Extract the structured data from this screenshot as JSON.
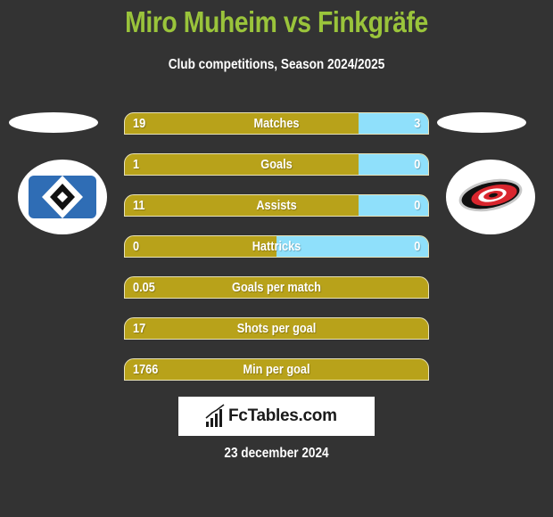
{
  "header": {
    "title": "Miro Muheim vs Finkgräfe",
    "subtitle": "Club competitions, Season 2024/2025"
  },
  "teams": {
    "left": {
      "logo": "hamburger-sv-logo"
    },
    "right": {
      "logo": "carolina-hurricanes-logo"
    }
  },
  "colors": {
    "background": "#333333",
    "title": "#9ac43b",
    "left_bar": "#b8a21a",
    "right_bar": "#8fe0fb"
  },
  "stats": [
    {
      "label": "Matches",
      "left": "19",
      "right": "3",
      "right_share": 0.23
    },
    {
      "label": "Goals",
      "left": "1",
      "right": "0",
      "right_share": 0.23
    },
    {
      "label": "Assists",
      "left": "11",
      "right": "0",
      "right_share": 0.23
    },
    {
      "label": "Hattricks",
      "left": "0",
      "right": "0",
      "right_share": 0.5
    },
    {
      "label": "Goals per match",
      "left": "0.05",
      "right": "",
      "right_share": 0
    },
    {
      "label": "Shots per goal",
      "left": "17",
      "right": "",
      "right_share": 0
    },
    {
      "label": "Min per goal",
      "left": "1766",
      "right": "",
      "right_share": 0
    }
  ],
  "footer": {
    "brand": "FcTables.com",
    "date": "23 december 2024"
  }
}
